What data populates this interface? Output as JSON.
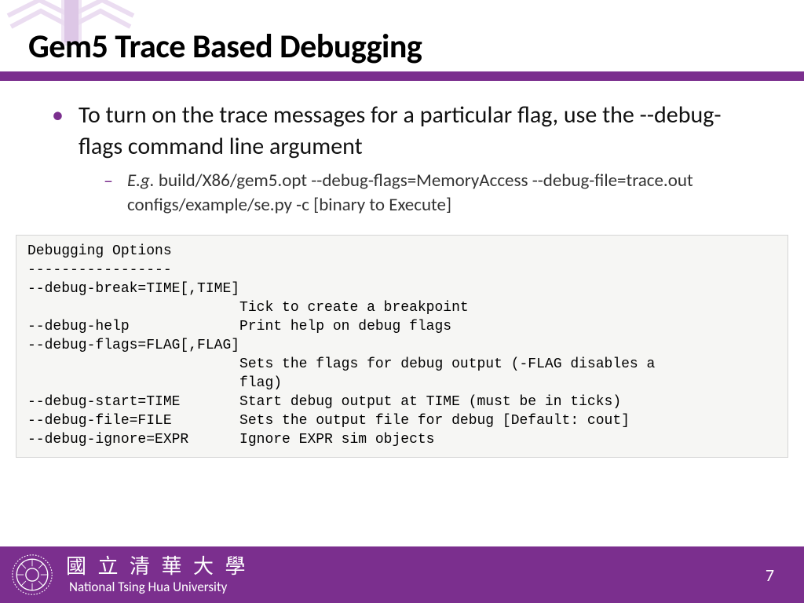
{
  "title": "Gem5 Trace Based Debugging",
  "bullet": "To turn on the trace messages for a particular flag, use the --debug-flags command line argument",
  "sub_eg_label": "E.g.",
  "sub_text": " build/X86/gem5.opt --debug-flags=MemoryAccess --debug-file=trace.out configs/example/se.py -c [binary to Execute]",
  "code": "Debugging Options\n-----------------\n--debug-break=TIME[,TIME]\n                         Tick to create a breakpoint\n--debug-help             Print help on debug flags\n--debug-flags=FLAG[,FLAG]\n                         Sets the flags for debug output (-FLAG disables a\n                         flag)\n--debug-start=TIME       Start debug output at TIME (must be in ticks)\n--debug-file=FILE        Sets the output file for debug [Default: cout]\n--debug-ignore=EXPR      Ignore EXPR sim objects",
  "footer": {
    "uni_cn": "國 立 清 華 大 學",
    "uni_en": "National Tsing Hua University",
    "page": "7"
  },
  "colors": {
    "brand": "#7B2F8E"
  }
}
